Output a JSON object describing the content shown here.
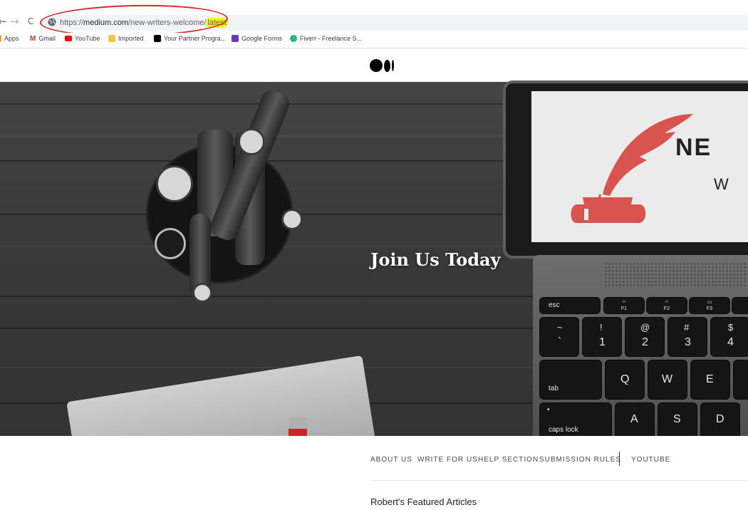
{
  "browser": {
    "nav_back": "←",
    "nav_forward": "→",
    "nav_reload": "C",
    "url_scheme": "https://",
    "url_host": "medium.com",
    "url_path": "/new-writers-welcome/",
    "url_highlight": "latest"
  },
  "bookmarks": [
    {
      "label": "Apps",
      "icon": "apps-icon",
      "color": "#e8a33d"
    },
    {
      "label": "Gmail",
      "icon": "gmail-icon",
      "color": "#d93025"
    },
    {
      "label": "YouTube",
      "icon": "youtube-icon",
      "color": "#ff0000"
    },
    {
      "label": "Imported",
      "icon": "folder-icon",
      "color": "#f4c542"
    },
    {
      "label": "Your Partner Progra...",
      "icon": "medium-icon",
      "color": "#000000"
    },
    {
      "label": "Google Forms",
      "icon": "forms-icon",
      "color": "#673ab7"
    },
    {
      "label": "Fiverr - Freelance S...",
      "icon": "fiverr-icon",
      "color": "#1dbf73"
    }
  ],
  "hero": {
    "title": "Join Us Today",
    "screen_line1": "NE",
    "screen_line2": "W",
    "brand_red": "#d9534f"
  },
  "keyboard": {
    "esc": "esc",
    "f1": "F1",
    "f2": "F2",
    "f3": "F3",
    "tilde": "~",
    "backtick": "`",
    "k1_top": "!",
    "k1": "1",
    "k2_top": "@",
    "k2": "2",
    "k3_top": "#",
    "k3": "3",
    "k4_top": "$",
    "k4": "4",
    "tab": "tab",
    "q": "Q",
    "w": "W",
    "e": "E",
    "caps": "caps lock",
    "a": "A",
    "s": "S",
    "d": "D"
  },
  "nav": {
    "about": "ABOUT US",
    "write": "WRITE FOR US",
    "help": "HELP SECTION",
    "rules": "SUBMISSION RULES",
    "youtube": "YOUTUBE"
  },
  "featured_heading": "Robert's Featured Articles",
  "colors": {
    "annotation": "#d9232a",
    "highlight": "#f5f500"
  }
}
